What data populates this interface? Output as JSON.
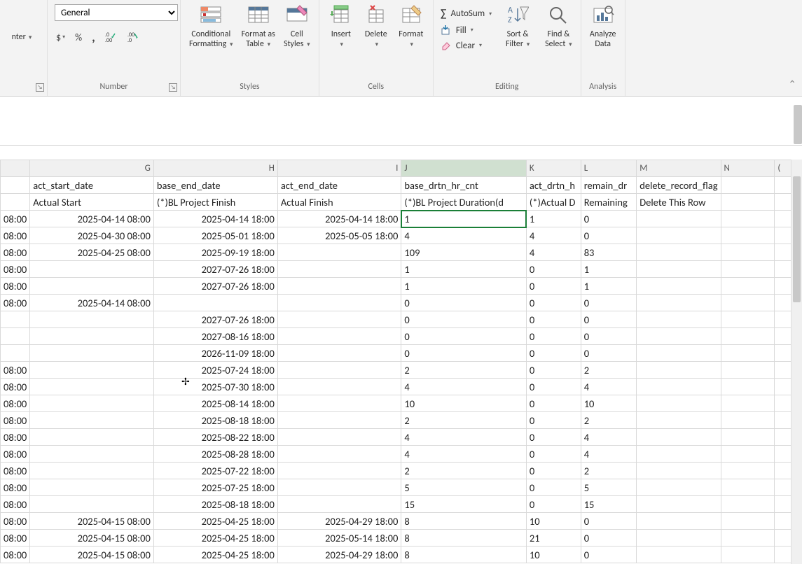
{
  "ribbon": {
    "alignment": {
      "merge_label": "nter",
      "group_label": ""
    },
    "number": {
      "format_value": "General",
      "accounting": "$",
      "percent": "%",
      "comma": ",",
      "inc_dec": ".0",
      "dec_dec": ".00",
      "group_label": "Number"
    },
    "styles": {
      "cond_fmt": "Conditional\nFormatting",
      "fmt_table": "Format as\nTable",
      "cell_styles": "Cell\nStyles",
      "group_label": "Styles"
    },
    "cells": {
      "insert": "Insert",
      "delete": "Delete",
      "format": "Format",
      "group_label": "Cells"
    },
    "editing": {
      "autosum": "AutoSum",
      "fill": "Fill",
      "clear": "Clear",
      "sort": "Sort &\nFilter",
      "find": "Find &\nSelect",
      "group_label": "Editing"
    },
    "analysis": {
      "analyze": "Analyze\nData",
      "group_label": "Analysis"
    }
  },
  "columns": [
    "",
    "G",
    "H",
    "I",
    "J",
    "K",
    "L",
    "M",
    "N",
    "("
  ],
  "header1": {
    "F": "",
    "G": "act_start_date",
    "H": "base_end_date",
    "I": "act_end_date",
    "J": "base_drtn_hr_cnt",
    "K": "act_drtn_h",
    "L": "remain_dr",
    "M": "delete_record_flag",
    "N": "",
    "O": ""
  },
  "header2": {
    "F": "",
    "G": "Actual Start",
    "H": "(*)BL Project Finish",
    "I": "Actual Finish",
    "J": "(*)BL Project Duration(d",
    "K": "(*)Actual D",
    "L": "Remaining",
    "M": "Delete This Row",
    "N": "",
    "O": ""
  },
  "rows": [
    {
      "F": "08:00",
      "G": "2025-04-14 08:00",
      "H": "2025-04-14 18:00",
      "I": "2025-04-14 18:00",
      "J": "1",
      "K": "1",
      "L": "0",
      "M": "",
      "N": ""
    },
    {
      "F": "08:00",
      "G": "2025-04-30 08:00",
      "H": "2025-05-01 18:00",
      "I": "2025-05-05 18:00",
      "J": "4",
      "K": "4",
      "L": "0",
      "M": "",
      "N": ""
    },
    {
      "F": "08:00",
      "G": "2025-04-25 08:00",
      "H": "2025-09-19 18:00",
      "I": "",
      "J": "109",
      "K": "4",
      "L": "83",
      "M": "",
      "N": ""
    },
    {
      "F": "08:00",
      "G": "",
      "H": "2027-07-26 18:00",
      "I": "",
      "J": "1",
      "K": "0",
      "L": "1",
      "M": "",
      "N": ""
    },
    {
      "F": "08:00",
      "G": "",
      "H": "2027-07-26 18:00",
      "I": "",
      "J": "1",
      "K": "0",
      "L": "1",
      "M": "",
      "N": ""
    },
    {
      "F": "08:00",
      "G": "2025-04-14 08:00",
      "H": "",
      "I": "",
      "J": "0",
      "K": "0",
      "L": "0",
      "M": "",
      "N": ""
    },
    {
      "F": "",
      "G": "",
      "H": "2027-07-26 18:00",
      "I": "",
      "J": "0",
      "K": "0",
      "L": "0",
      "M": "",
      "N": ""
    },
    {
      "F": "",
      "G": "",
      "H": "2027-08-16 18:00",
      "I": "",
      "J": "0",
      "K": "0",
      "L": "0",
      "M": "",
      "N": ""
    },
    {
      "F": "",
      "G": "",
      "H": "2026-11-09 18:00",
      "I": "",
      "J": "0",
      "K": "0",
      "L": "0",
      "M": "",
      "N": ""
    },
    {
      "F": "08:00",
      "G": "",
      "H": "2025-07-24 18:00",
      "I": "",
      "J": "2",
      "K": "0",
      "L": "2",
      "M": "",
      "N": ""
    },
    {
      "F": "08:00",
      "G": "",
      "H": "2025-07-30 18:00",
      "I": "",
      "J": "4",
      "K": "0",
      "L": "4",
      "M": "",
      "N": ""
    },
    {
      "F": "08:00",
      "G": "",
      "H": "2025-08-14 18:00",
      "I": "",
      "J": "10",
      "K": "0",
      "L": "10",
      "M": "",
      "N": ""
    },
    {
      "F": "08:00",
      "G": "",
      "H": "2025-08-18 18:00",
      "I": "",
      "J": "2",
      "K": "0",
      "L": "2",
      "M": "",
      "N": ""
    },
    {
      "F": "08:00",
      "G": "",
      "H": "2025-08-22 18:00",
      "I": "",
      "J": "4",
      "K": "0",
      "L": "4",
      "M": "",
      "N": ""
    },
    {
      "F": "08:00",
      "G": "",
      "H": "2025-08-28 18:00",
      "I": "",
      "J": "4",
      "K": "0",
      "L": "4",
      "M": "",
      "N": ""
    },
    {
      "F": "08:00",
      "G": "",
      "H": "2025-07-22 18:00",
      "I": "",
      "J": "2",
      "K": "0",
      "L": "2",
      "M": "",
      "N": ""
    },
    {
      "F": "08:00",
      "G": "",
      "H": "2025-07-25 18:00",
      "I": "",
      "J": "5",
      "K": "0",
      "L": "5",
      "M": "",
      "N": ""
    },
    {
      "F": "08:00",
      "G": "",
      "H": "2025-08-18 18:00",
      "I": "",
      "J": "15",
      "K": "0",
      "L": "15",
      "M": "",
      "N": ""
    },
    {
      "F": "08:00",
      "G": "2025-04-15 08:00",
      "H": "2025-04-25 18:00",
      "I": "2025-04-29 18:00",
      "J": "8",
      "K": "10",
      "L": "0",
      "M": "",
      "N": ""
    },
    {
      "F": "08:00",
      "G": "2025-04-15 08:00",
      "H": "2025-04-25 18:00",
      "I": "2025-05-14 18:00",
      "J": "8",
      "K": "21",
      "L": "0",
      "M": "",
      "N": ""
    },
    {
      "F": "08:00",
      "G": "2025-04-15 08:00",
      "H": "2025-04-25 18:00",
      "I": "2025-04-29 18:00",
      "J": "8",
      "K": "10",
      "L": "0",
      "M": "",
      "N": ""
    }
  ],
  "selected": {
    "col": "J",
    "row": 0
  }
}
